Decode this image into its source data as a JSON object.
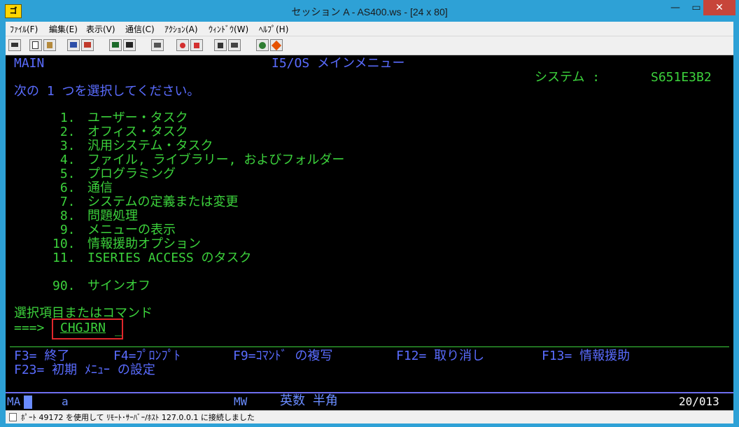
{
  "window": {
    "title": "セッション A - AS400.ws - [24 x 80]",
    "app_icon_label": "ゴ",
    "controls": {
      "minimize": "—",
      "maximize": "▭",
      "close": "✕"
    }
  },
  "menubar": [
    "ﾌｧｲﾙ(F)",
    "編集(E)",
    "表示(V)",
    "通信(C)",
    "ｱｸｼｮﾝ(A)",
    "ｳｨﾝﾄﾞｳ(W)",
    "ﾍﾙﾌﾟ(H)"
  ],
  "toolbar": {
    "buttons": [
      "print-icon",
      "copy-icon",
      "paste-icon",
      "send-file-icon",
      "receive-file-icon",
      "display-icon",
      "keypad-icon",
      "macro-icon",
      "record-icon",
      "stop-icon",
      "play-icon",
      "edit-icon",
      "globe-icon",
      "help-icon"
    ]
  },
  "screen": {
    "menu_id": "MAIN",
    "menu_title": "I5/OS メインメニュー",
    "system_label": "システム :",
    "system_name": "S651E3B2",
    "instruction": "次の 1 つを選択してください。",
    "options": [
      {
        "num": " 1.",
        "text": "ユーザー・タスク"
      },
      {
        "num": " 2.",
        "text": "オフィス・タスク"
      },
      {
        "num": " 3.",
        "text": "汎用システム・タスク"
      },
      {
        "num": " 4.",
        "text": "ファイル, ライブラリー, およびフォルダー"
      },
      {
        "num": " 5.",
        "text": "プログラミング"
      },
      {
        "num": " 6.",
        "text": "通信"
      },
      {
        "num": " 7.",
        "text": "システムの定義または変更"
      },
      {
        "num": " 8.",
        "text": "問題処理"
      },
      {
        "num": " 9.",
        "text": "メニューの表示"
      },
      {
        "num": "10.",
        "text": "情報援助オプション"
      },
      {
        "num": "11.",
        "text": "ISERIES ACCESS のタスク"
      },
      {
        "num": "90.",
        "text": "サインオフ"
      }
    ],
    "prompt_label": "選択項目またはコマンド",
    "prompt_arrow": "===>",
    "command_value": "CHGJRN",
    "fkeys_line1": [
      "F3= 終了",
      "F4=ﾌﾟﾛﾝﾌﾟﾄ",
      "F9=ｺﾏﾝﾄﾞ の複写",
      "F12= 取り消し",
      "F13= 情報援助"
    ],
    "fkeys_line2": "F23= 初期 ﾒﾆｭｰ の設定"
  },
  "oia": {
    "left": "MA",
    "input": "a",
    "mw": "MW",
    "mode": "英数 半角",
    "cursor_pos": "20/013"
  },
  "statusbar": {
    "text": "ﾎﾟｰﾄ 49172 を使用して ﾘﾓｰﾄ･ｻｰﾊﾞｰ/ﾎｽﾄ 127.0.0.1 に接続しました"
  },
  "colors": {
    "field_blue": "#5a6cff",
    "text_green": "#3cd23c",
    "highlight_red": "#e0272b"
  }
}
